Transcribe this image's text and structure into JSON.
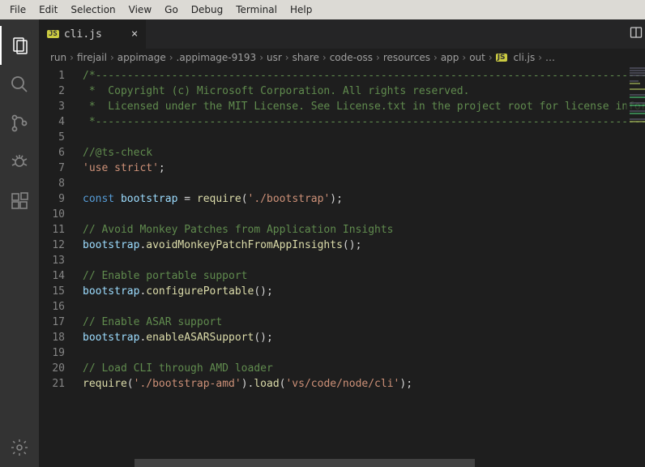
{
  "menubar": [
    "File",
    "Edit",
    "Selection",
    "View",
    "Go",
    "Debug",
    "Terminal",
    "Help"
  ],
  "tab": {
    "badge": "JS",
    "title": "cli.js"
  },
  "breadcrumb": {
    "items": [
      "run",
      "firejail",
      "appimage",
      ".appimage-9193",
      "usr",
      "share",
      "code-oss",
      "resources",
      "app",
      "out"
    ],
    "fileBadge": "JS",
    "file": "cli.js",
    "tail": "…"
  },
  "lineCount": 21,
  "code": {
    "1": [
      {
        "c": "tok-comment",
        "t": "/*---------------------------------------------------------------------------------------------"
      }
    ],
    "2": [
      {
        "c": "tok-comment",
        "t": " *  Copyright (c) Microsoft Corporation. All rights reserved."
      }
    ],
    "3": [
      {
        "c": "tok-comment",
        "t": " *  Licensed under the MIT License. See License.txt in the project root for license information."
      }
    ],
    "4": [
      {
        "c": "tok-comment",
        "t": " *--------------------------------------------------------------------------------------------*/"
      }
    ],
    "5": [],
    "6": [
      {
        "c": "tok-comment",
        "t": "//@ts-check"
      }
    ],
    "7": [
      {
        "c": "tok-string",
        "t": "'use strict'"
      },
      {
        "c": "tok-plain",
        "t": ";"
      }
    ],
    "8": [],
    "9": [
      {
        "c": "tok-keyword",
        "t": "const"
      },
      {
        "c": "tok-plain",
        "t": " "
      },
      {
        "c": "tok-var",
        "t": "bootstrap"
      },
      {
        "c": "tok-plain",
        "t": " = "
      },
      {
        "c": "tok-func",
        "t": "require"
      },
      {
        "c": "tok-plain",
        "t": "("
      },
      {
        "c": "tok-string",
        "t": "'./bootstrap'"
      },
      {
        "c": "tok-plain",
        "t": ");"
      }
    ],
    "10": [],
    "11": [
      {
        "c": "tok-comment",
        "t": "// Avoid Monkey Patches from Application Insights"
      }
    ],
    "12": [
      {
        "c": "tok-var",
        "t": "bootstrap"
      },
      {
        "c": "tok-plain",
        "t": "."
      },
      {
        "c": "tok-func",
        "t": "avoidMonkeyPatchFromAppInsights"
      },
      {
        "c": "tok-plain",
        "t": "();"
      }
    ],
    "13": [],
    "14": [
      {
        "c": "tok-comment",
        "t": "// Enable portable support"
      }
    ],
    "15": [
      {
        "c": "tok-var",
        "t": "bootstrap"
      },
      {
        "c": "tok-plain",
        "t": "."
      },
      {
        "c": "tok-func",
        "t": "configurePortable"
      },
      {
        "c": "tok-plain",
        "t": "();"
      }
    ],
    "16": [],
    "17": [
      {
        "c": "tok-comment",
        "t": "// Enable ASAR support"
      }
    ],
    "18": [
      {
        "c": "tok-var",
        "t": "bootstrap"
      },
      {
        "c": "tok-plain",
        "t": "."
      },
      {
        "c": "tok-func",
        "t": "enableASARSupport"
      },
      {
        "c": "tok-plain",
        "t": "();"
      }
    ],
    "19": [],
    "20": [
      {
        "c": "tok-comment",
        "t": "// Load CLI through AMD loader"
      }
    ],
    "21": [
      {
        "c": "tok-func",
        "t": "require"
      },
      {
        "c": "tok-plain",
        "t": "("
      },
      {
        "c": "tok-string",
        "t": "'./bootstrap-amd'"
      },
      {
        "c": "tok-plain",
        "t": ")."
      },
      {
        "c": "tok-func",
        "t": "load"
      },
      {
        "c": "tok-plain",
        "t": "("
      },
      {
        "c": "tok-string",
        "t": "'vs/code/node/cli'"
      },
      {
        "c": "tok-plain",
        "t": ");"
      }
    ]
  }
}
